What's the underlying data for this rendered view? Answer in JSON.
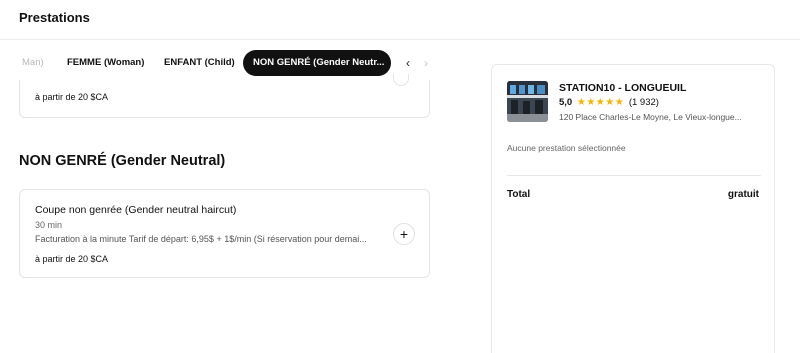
{
  "header": {
    "title": "Prestations"
  },
  "tabs": {
    "items": [
      {
        "label": "Man)"
      },
      {
        "label": "FEMME (Woman)"
      },
      {
        "label": "ENFANT (Child)"
      },
      {
        "label": "NON GENRÉ (Gender Neutr..."
      }
    ],
    "active_index": 3,
    "prev_icon": "‹",
    "next_icon": "›"
  },
  "previous_service": {
    "price": "à partir de 20 $CA"
  },
  "section": {
    "title": "NON GENRÉ (Gender Neutral)"
  },
  "service": {
    "name": "Coupe non genrée (Gender neutral haircut)",
    "duration": "30 min",
    "description": "Facturation à la minute Tarif de départ: 6,95$ + 1$/min (Si réservation pour demai...",
    "price": "à partir de 20 $CA",
    "add_icon": "+"
  },
  "summary": {
    "shop_name": "STATION10 - LONGUEUIL",
    "rating": "5,0",
    "stars": "★★★★★",
    "review_count": "(1 932)",
    "address": "120 Place Charles-Le Moyne, Le Vieux-longue...",
    "empty_text": "Aucune prestation sélectionnée",
    "total_label": "Total",
    "total_value": "gratuit"
  },
  "colors": {
    "active_tab_bg": "#111111",
    "star": "#f5b400",
    "border": "#e4e4e4"
  },
  "icons": [
    "chevron-left-icon",
    "chevron-right-icon",
    "plus-icon",
    "star-icon"
  ]
}
